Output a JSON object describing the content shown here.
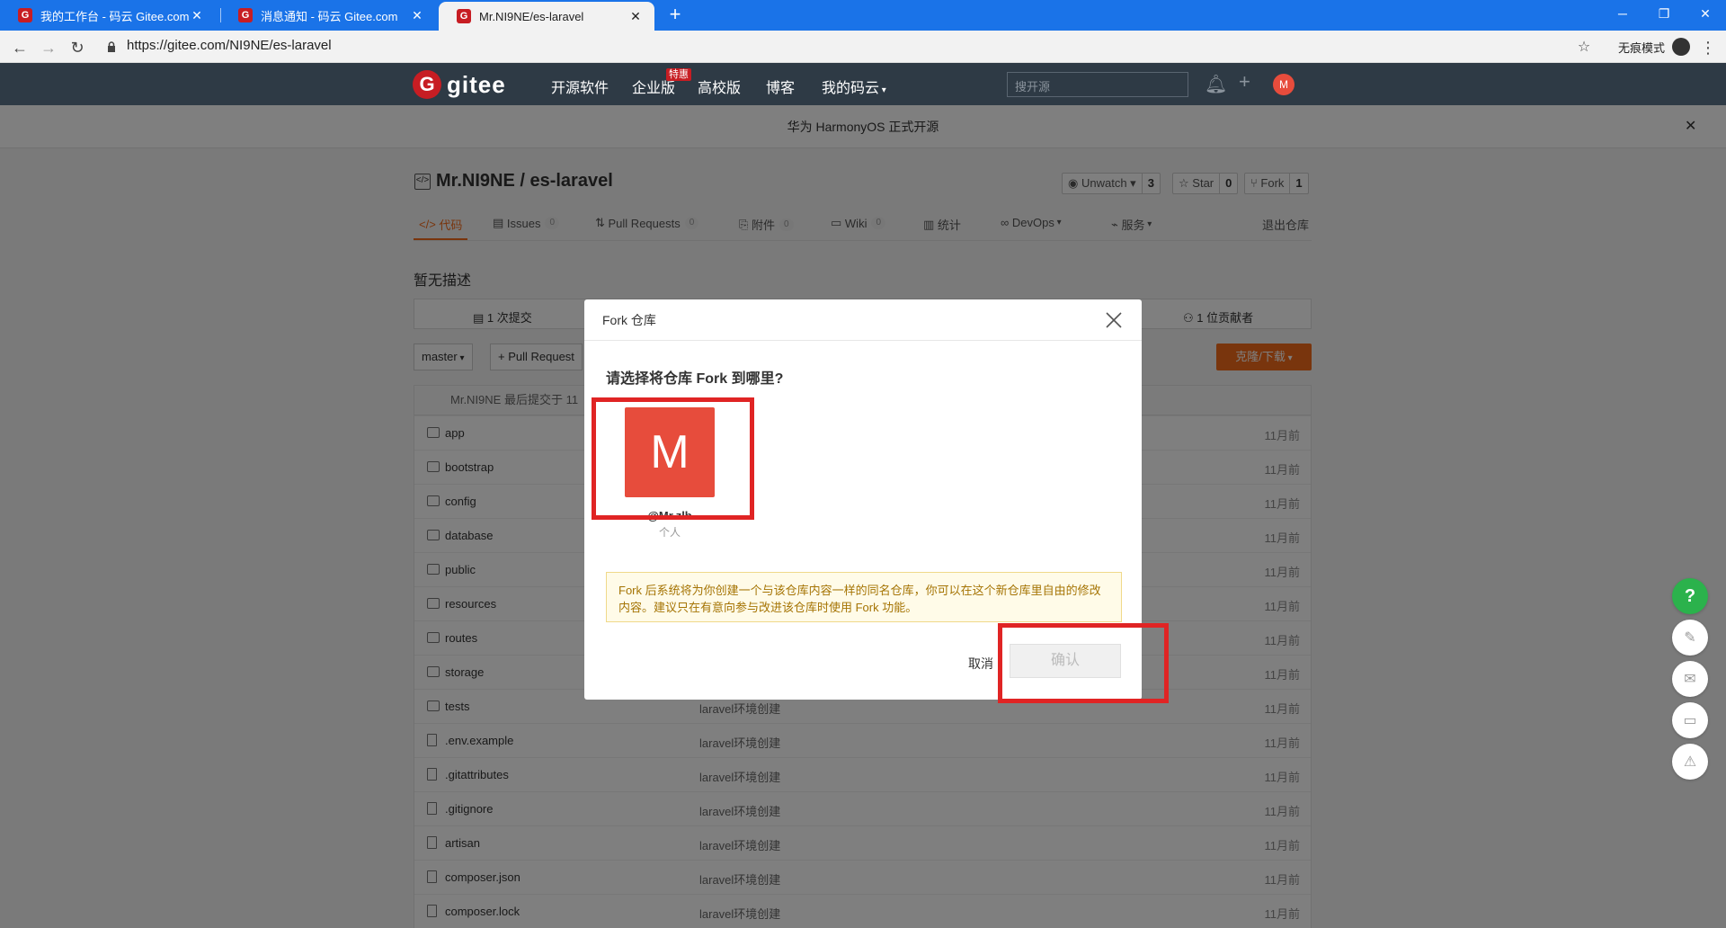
{
  "browser": {
    "tabs": [
      {
        "title": "我的工作台 - 码云 Gitee.com"
      },
      {
        "title": "消息通知 - 码云 Gitee.com"
      },
      {
        "title": "Mr.NI9NE/es-laravel"
      }
    ],
    "url": "https://gitee.com/NI9NE/es-laravel",
    "incognito_label": "无痕模式",
    "favicon_letter": "G"
  },
  "header": {
    "logo_text": "gitee",
    "nav": [
      "开源软件",
      "企业版",
      "高校版",
      "博客",
      "我的码云"
    ],
    "enterprise_badge": "特惠",
    "search_placeholder": "搜开源",
    "avatar_letter": "M"
  },
  "banner": {
    "text": "华为 HarmonyOS 正式开源"
  },
  "repo": {
    "title": "Mr.NI9NE / es-laravel",
    "watch": {
      "label": "Unwatch",
      "count": "3"
    },
    "star": {
      "label": "Star",
      "count": "0"
    },
    "fork": {
      "label": "Fork",
      "count": "1"
    },
    "tabs": [
      {
        "label": "代码"
      },
      {
        "label": "Issues",
        "count": "0"
      },
      {
        "label": "Pull Requests",
        "count": "0"
      },
      {
        "label": "附件",
        "count": "0"
      },
      {
        "label": "Wiki",
        "count": "0"
      },
      {
        "label": "统计"
      },
      {
        "label": "DevOps"
      },
      {
        "label": "服务"
      }
    ],
    "exit_label": "退出仓库",
    "description": "暂无描述",
    "commits_label": "1 次提交",
    "contributors_label": "1 位贡献者",
    "branch": "master",
    "pr_button": "+ Pull Request",
    "clone_button": "克隆/下载",
    "last_commit": "Mr.NI9NE 最后提交于 11",
    "files": [
      {
        "name": "app",
        "type": "folder",
        "message": "",
        "time": "11月前"
      },
      {
        "name": "bootstrap",
        "type": "folder",
        "message": "",
        "time": "11月前"
      },
      {
        "name": "config",
        "type": "folder",
        "message": "",
        "time": "11月前"
      },
      {
        "name": "database",
        "type": "folder",
        "message": "",
        "time": "11月前"
      },
      {
        "name": "public",
        "type": "folder",
        "message": "",
        "time": "11月前"
      },
      {
        "name": "resources",
        "type": "folder",
        "message": "",
        "time": "11月前"
      },
      {
        "name": "routes",
        "type": "folder",
        "message": "",
        "time": "11月前"
      },
      {
        "name": "storage",
        "type": "folder",
        "message": "",
        "time": "11月前"
      },
      {
        "name": "tests",
        "type": "folder",
        "message": "laravel环境创建",
        "time": "11月前"
      },
      {
        "name": ".env.example",
        "type": "file",
        "message": "laravel环境创建",
        "time": "11月前"
      },
      {
        "name": ".gitattributes",
        "type": "file",
        "message": "laravel环境创建",
        "time": "11月前"
      },
      {
        "name": ".gitignore",
        "type": "file",
        "message": "laravel环境创建",
        "time": "11月前"
      },
      {
        "name": "artisan",
        "type": "file",
        "message": "laravel环境创建",
        "time": "11月前"
      },
      {
        "name": "composer.json",
        "type": "file",
        "message": "laravel环境创建",
        "time": "11月前"
      },
      {
        "name": "composer.lock",
        "type": "file",
        "message": "laravel环境创建",
        "time": "11月前"
      }
    ]
  },
  "modal": {
    "title": "Fork 仓库",
    "question": "请选择将仓库 Fork 到哪里?",
    "owner": {
      "avatar_letter": "M",
      "name": "@Mr.zlb",
      "type": "个人"
    },
    "tip": "Fork 后系统将为你创建一个与该仓库内容一样的同名仓库，你可以在这个新仓库里自由的修改内容。建议只在有意向参与改进该仓库时使用 Fork 功能。",
    "cancel": "取消",
    "confirm": "确认"
  },
  "float_help": "?",
  "colors": {
    "brand": "#c71d23",
    "accent": "#f26b1a",
    "highlight": "#e02424"
  }
}
